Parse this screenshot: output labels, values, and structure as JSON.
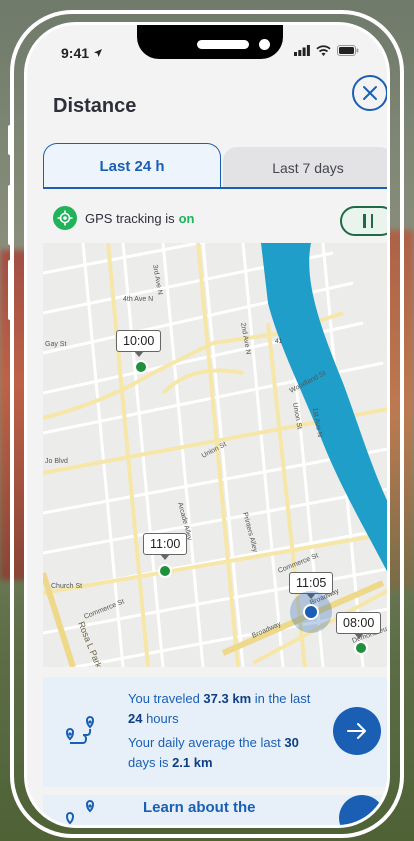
{
  "status_bar": {
    "time": "9:41"
  },
  "header": {
    "title": "Distance"
  },
  "tabs": [
    {
      "label": "Last 24 h",
      "active": true
    },
    {
      "label": "Last 7 days",
      "active": false
    }
  ],
  "gps": {
    "label": "GPS tracking is",
    "state": "on",
    "toggle_on": true
  },
  "map": {
    "street_labels": [
      "3rd Ave N",
      "4th Ave N",
      "2nd Ave N",
      "Gay St",
      "Woodland St",
      "Union St",
      "1st Ave N",
      "Jo Blvd",
      "Church St",
      "Commerce St",
      "Broadway",
      "Rosa L Parks",
      "Printers Alley",
      "Arcade Alley",
      "Union St",
      "Demonbreun"
    ],
    "pins": [
      {
        "time": "10:00",
        "kind": "stop"
      },
      {
        "time": "11:00",
        "kind": "stop"
      },
      {
        "time": "11:05",
        "kind": "current"
      },
      {
        "time": "08:00",
        "kind": "stop"
      }
    ],
    "colors": {
      "water": "#1f9ec9",
      "stop_pin": "#1e8f3a",
      "current_pin": "#1a5fb4"
    }
  },
  "summary": {
    "line1_pre": "You traveled ",
    "distance": "37.3 km",
    "line1_mid": " in the last ",
    "hours": "24",
    "line1_post": " hours",
    "line2_pre": "Your daily average the last ",
    "days": "30",
    "line2_mid": " days is ",
    "average": "2.1 km"
  },
  "learn": {
    "label": "Learn about the"
  },
  "colors": {
    "accent": "#1a5fb4",
    "green": "#21b35a"
  }
}
